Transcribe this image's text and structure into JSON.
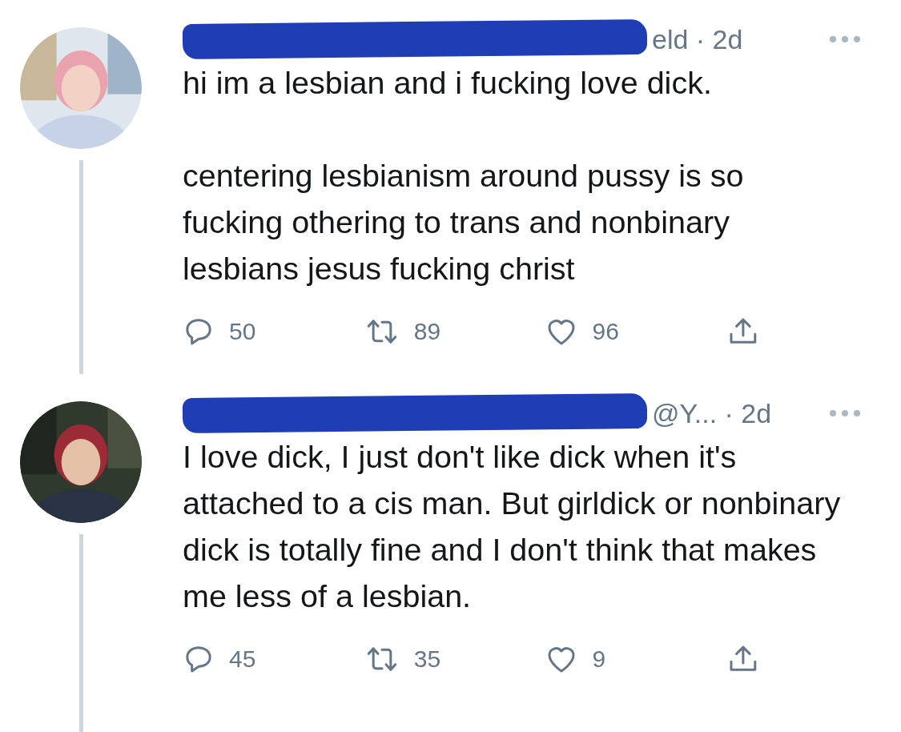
{
  "tweets": [
    {
      "meta": "eld · 2d",
      "paragraphs": [
        "hi im a lesbian and i fucking love dick.",
        "centering lesbianism around pussy is so fucking othering to trans and nonbinary lesbians jesus fucking christ"
      ],
      "replies": "50",
      "retweets": "89",
      "likes": "96"
    },
    {
      "meta": "@Y... · 2d",
      "paragraphs": [
        "I love dick, I just don't like dick when it's attached to a cis man. But girldick or nonbinary dick is totally fine and I don't think that makes me less of a lesbian."
      ],
      "replies": "45",
      "retweets": "35",
      "likes": "9"
    }
  ]
}
